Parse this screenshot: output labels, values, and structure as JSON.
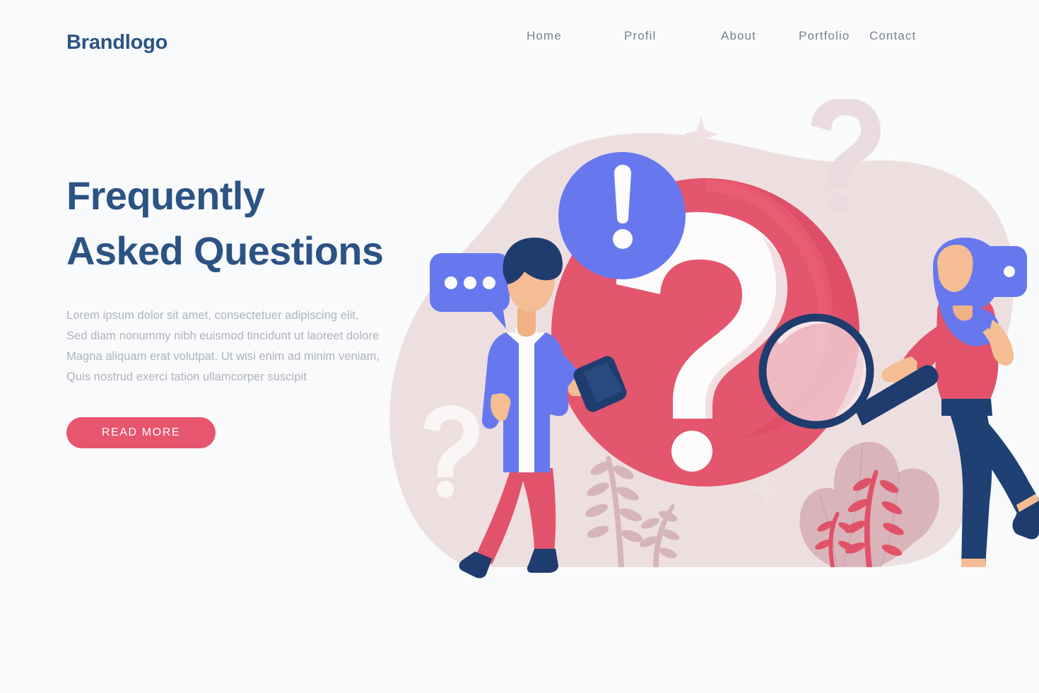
{
  "header": {
    "brand": "Brandlogo",
    "nav": [
      {
        "label": "Home"
      },
      {
        "label": "Profil"
      },
      {
        "label": "About"
      },
      {
        "label": "Portfolio"
      },
      {
        "label": "Contact"
      }
    ]
  },
  "hero": {
    "title_line1": "Frequently",
    "title_line2": "Asked Questions",
    "paragraph_line1": "Lorem ipsum dolor sit amet, consectetuer adipiscing elit,",
    "paragraph_line2": "Sed diam nonummy nibh euismod tincidunt ut laoreet dolore",
    "paragraph_line3": "Magna aliquam erat volutpat. Ut wisi enim ad minim veniam,",
    "paragraph_line4": "Quis nostrud exerci tation ullamcorper suscipit",
    "cta_label": "READ MORE"
  },
  "illustration": {
    "alt": "FAQ illustration with two people, a large question mark and a magnifying glass",
    "elements": [
      "background-blob",
      "large-question-mark-circle",
      "exclamation-badge",
      "chat-bubble-left",
      "chat-bubble-right",
      "magnifier",
      "male-character",
      "female-character",
      "decorative-question-mark-top-right",
      "decorative-question-mark-left",
      "sparkles",
      "plants"
    ]
  },
  "colors": {
    "page_background": "#F9FAFC",
    "brand_navy": "#2B5384",
    "accent_red": "#E8556E",
    "accent_blue": "#6778EF",
    "body_text": "#AFB4B9",
    "nav_text": "#7C8289",
    "blob_pink": "#EDDFE0",
    "mauve": "#CFA7AD",
    "deep_navy": "#1F3C6E"
  }
}
